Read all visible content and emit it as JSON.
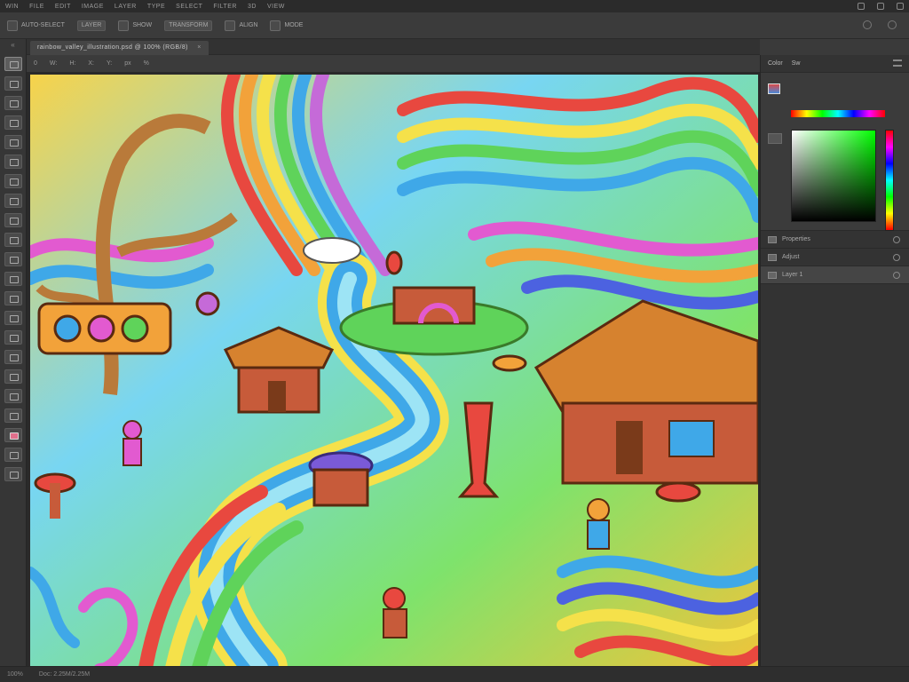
{
  "menubar": {
    "items": [
      "WIN",
      "FILE",
      "EDIT",
      "IMAGE",
      "LAYER",
      "TYPE",
      "SELECT",
      "FILTER",
      "3D",
      "VIEW"
    ]
  },
  "options": {
    "items": [
      "AUTO-SELECT",
      "LAYER",
      "SHOW",
      "TRANSFORM",
      "ALIGN",
      "MODE"
    ]
  },
  "document": {
    "tab_title": "rainbow_valley_illustration.psd @ 100% (RGB/8)",
    "tab_close": "×"
  },
  "ruler": {
    "items": [
      "0",
      "W:",
      "H:",
      "X:",
      "Y:",
      "px",
      "%"
    ]
  },
  "panel": {
    "tab_color": "Color",
    "tab_swatches": "Sw",
    "rows": [
      {
        "label": "Properties",
        "highlighted": false
      },
      {
        "label": "Adjust",
        "highlighted": false
      },
      {
        "label": "Layer 1",
        "highlighted": true
      }
    ]
  },
  "status": {
    "zoom": "100%",
    "doc_size": "Doc: 2.25M/2.25M"
  },
  "colors": {
    "chrome_dark": "#2b2b2b",
    "chrome_mid": "#3b3b3b",
    "foreground": "#d84a4a"
  }
}
